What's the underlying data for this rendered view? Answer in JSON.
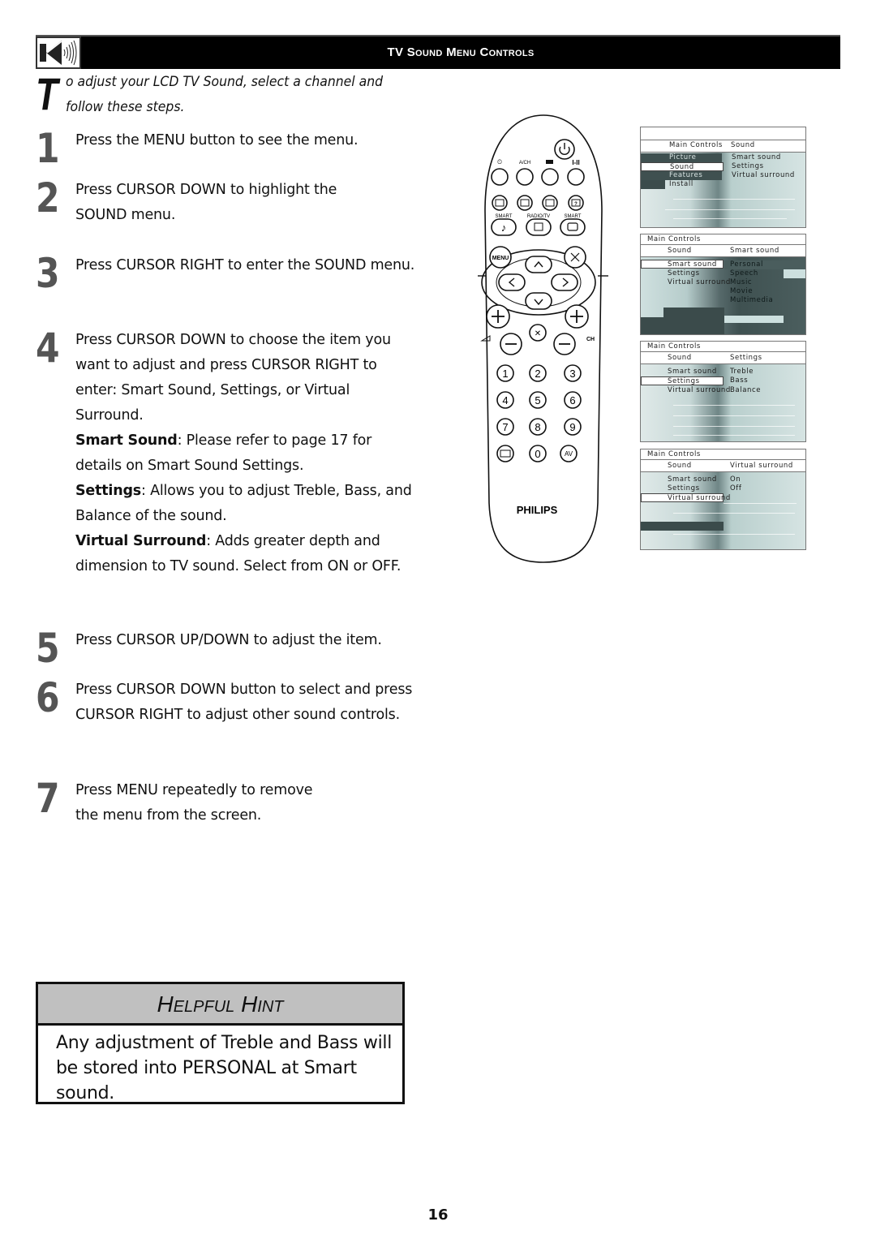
{
  "header": {
    "icon": "speaker-sound-icon",
    "title": "TV Sound Menu Controls"
  },
  "intro": {
    "dropcap": "T",
    "text": "o adjust your LCD TV Sound, select a channel and follow these steps."
  },
  "steps": [
    {
      "num": "1",
      "text": "Press the MENU button to see the menu."
    },
    {
      "num": "2",
      "text": "Press CURSOR DOWN to highlight the SOUND menu."
    },
    {
      "num": "3",
      "text": "Press CURSOR RIGHT to enter the SOUND menu."
    },
    {
      "num": "4",
      "text": "Press CURSOR DOWN to choose the item you want to adjust and press CURSOR RIGHT to enter: Smart Sound, Settings, or Virtual Surround.",
      "details": [
        {
          "term": "Smart Sound",
          "desc": ": Please refer to page 17 for details on Smart Sound Settings."
        },
        {
          "term": "Settings",
          "desc": ": Allows you to adjust Treble, Bass, and Balance of the sound."
        },
        {
          "term": "Virtual Surround",
          "desc": ": Adds greater depth and dimension to TV sound. Select from ON or OFF."
        }
      ]
    },
    {
      "num": "5",
      "text": "Press CURSOR UP/DOWN to adjust the item."
    },
    {
      "num": "6",
      "text": "Press CURSOR DOWN button to select and press CURSOR RIGHT to adjust other sound controls."
    },
    {
      "num": "7",
      "text": "Press MENU repeatedly to remove the menu from the screen."
    }
  ],
  "remote": {
    "brand": "PHILIPS",
    "labels": {
      "a_ch": "A/CH",
      "dual": "I-II",
      "smart_left": "SMART",
      "radio_tv": "RADIO/TV",
      "smart_right": "SMART",
      "menu": "MENU",
      "ch": "CH",
      "av": "AV"
    },
    "digits": [
      "1",
      "2",
      "3",
      "4",
      "5",
      "6",
      "7",
      "8",
      "9",
      "0"
    ]
  },
  "tv_screens": [
    {
      "header_left": "Main Controls",
      "header_right": "Sound",
      "left_items": [
        "Picture",
        "Sound",
        "Features",
        "Install"
      ],
      "selected_left": "Sound",
      "right_items": [
        "Smart sound",
        "Settings",
        "Virtual surround"
      ]
    },
    {
      "title": "Main Controls",
      "header_left": "Sound",
      "header_right": "Smart sound",
      "left_items": [
        "Smart sound",
        "Settings",
        "Virtual surround"
      ],
      "selected_left": "Smart sound",
      "right_items": [
        "Personal",
        "Speech",
        "Music",
        "Movie",
        "Multimedia"
      ]
    },
    {
      "title": "Main Controls",
      "header_left": "Sound",
      "header_right": "Settings",
      "left_items": [
        "Smart sound",
        "Settings",
        "Virtual surround"
      ],
      "selected_left": "Settings",
      "right_items": [
        "Treble",
        "Bass",
        "Balance"
      ]
    },
    {
      "title": "Main Controls",
      "header_left": "Sound",
      "header_right": "Virtual surround",
      "left_items": [
        "Smart sound",
        "Settings",
        "Virtual surround"
      ],
      "selected_left": "Virtual surround",
      "right_items": [
        "On",
        "Off"
      ]
    }
  ],
  "hint": {
    "title": "Helpful Hint",
    "body": "Any adjustment of Treble and Bass will be stored into PERSONAL at Smart sound."
  },
  "page_number": "16"
}
